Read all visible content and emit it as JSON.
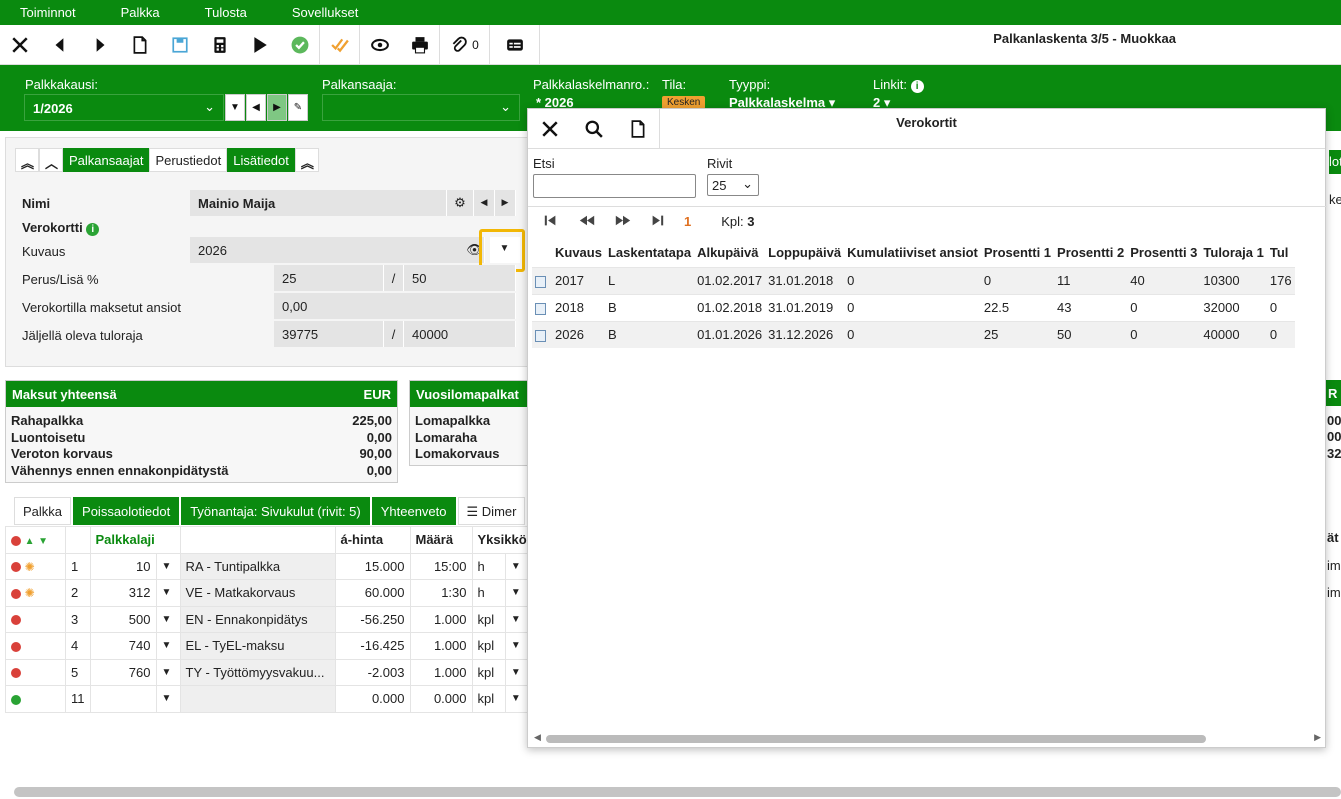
{
  "menu": [
    "Toiminnot",
    "Palkka",
    "Tulosta",
    "Sovellukset"
  ],
  "toolbar": {
    "attachment_count": "0",
    "title": "Palkanlaskenta 3/5 - Muokkaa"
  },
  "header": {
    "period_label": "Palkkakausi:",
    "period_value": "1/2026",
    "employee_label": "Palkansaaja:",
    "employee_value": "",
    "calcno_label": "Palkkalaskelmanro.:",
    "calcno_value": "* 2026",
    "status_label": "Tila:",
    "status_value": "Kesken",
    "type_label": "Tyyppi:",
    "type_value": "Palkkalaskelma",
    "links_label": "Linkit:",
    "links_value": "2"
  },
  "detail_tabs": [
    "Palkansaajat",
    "Perustiedot",
    "Lisätiedot"
  ],
  "detail": {
    "name_label": "Nimi",
    "name_value": "Mainio Maija",
    "taxcard_label": "Verokortti",
    "desc_label": "Kuvaus",
    "desc_value": "2026",
    "rate_label": "Perus/Lisä %",
    "rate_base": "25",
    "rate_extra": "50",
    "paid_label": "Verokortilla maksetut ansiot",
    "paid_value": "0,00",
    "remaining_label": "Jäljellä oleva tuloraja",
    "remaining_value": "39775",
    "limit_value": "40000",
    "slash": "/"
  },
  "payments": {
    "title": "Maksut yhteensä",
    "currency": "EUR",
    "rows": [
      {
        "label": "Rahapalkka",
        "value": "225,00"
      },
      {
        "label": "Luontoisetu",
        "value": "0,00"
      },
      {
        "label": "Veroton korvaus",
        "value": "90,00"
      },
      {
        "label": "Vähennys ennen ennakonpidätystä",
        "value": "0,00"
      }
    ]
  },
  "holiday": {
    "title": "Vuosilomapalkat",
    "rows": [
      "Lomapalkka",
      "Lomaraha",
      "Lomakorvaus"
    ]
  },
  "bottom_tabs": [
    "Palkka",
    "Poissaolotiedot",
    "Työnantaja: Sivukulut (rivit: 5)",
    "Yhteenveto",
    "Dimer"
  ],
  "pay_table": {
    "headers": {
      "paytype": "Palkkalaji",
      "price": "á-hinta",
      "qty": "Määrä",
      "unit": "Yksikkö"
    },
    "rows": [
      {
        "no": "1",
        "code": "10",
        "name": "RA - Tuntipalkka",
        "price": "15.000",
        "qty": "15:00",
        "unit": "h"
      },
      {
        "no": "2",
        "code": "312",
        "name": "VE - Matkakorvaus",
        "price": "60.000",
        "qty": "1:30",
        "unit": "h"
      },
      {
        "no": "3",
        "code": "500",
        "name": "EN - Ennakonpidätys",
        "price": "-56.250",
        "qty": "1.000",
        "unit": "kpl"
      },
      {
        "no": "4",
        "code": "740",
        "name": "EL - TyEL-maksu",
        "price": "-16.425",
        "qty": "1.000",
        "unit": "kpl"
      },
      {
        "no": "5",
        "code": "760",
        "name": "TY - Työttömyysvakuu...",
        "price": "-2.003",
        "qty": "1.000",
        "unit": "kpl"
      },
      {
        "no": "11",
        "code": "",
        "name": "",
        "price": "0.000",
        "qty": "0.000",
        "unit": "kpl"
      }
    ]
  },
  "modal": {
    "title": "Verokortit",
    "search_label": "Etsi",
    "search_value": "",
    "rows_label": "Rivit",
    "rows_value": "25",
    "page": "1",
    "count_label": "Kpl:",
    "count_value": "3",
    "columns": [
      "Kuvaus",
      "Laskentatapa",
      "Alkupäivä",
      "Loppupäivä",
      "Kumulatiiviset ansiot",
      "Prosentti 1",
      "Prosentti 2",
      "Prosentti 3",
      "Tuloraja 1",
      "Tul"
    ],
    "rows": [
      [
        "2017",
        "L",
        "01.02.2017",
        "31.01.2018",
        "0",
        "0",
        "11",
        "40",
        "10300",
        "176"
      ],
      [
        "2018",
        "B",
        "01.02.2018",
        "31.01.2019",
        "0",
        "22.5",
        "43",
        "0",
        "32000",
        "0"
      ],
      [
        "2026",
        "B",
        "01.01.2026",
        "31.12.2026",
        "0",
        "25",
        "50",
        "0",
        "40000",
        "0"
      ]
    ]
  },
  "right_edge": {
    "r1": "lot",
    "r2": "kertoi",
    "r3": "R",
    "r4": "00",
    "r5": "00",
    "r6": "32",
    "r7": "ät",
    "r8": "im",
    "r9": "im"
  }
}
